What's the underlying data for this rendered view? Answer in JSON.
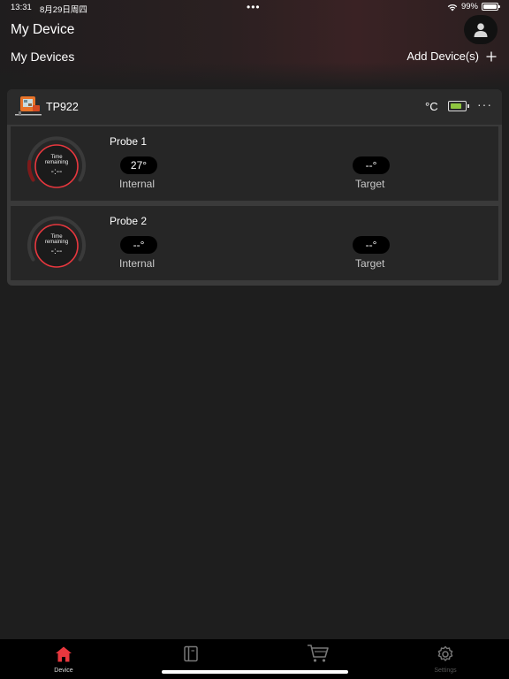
{
  "status_bar": {
    "time": "13:31",
    "date": "8月29日周四",
    "dots": "•••",
    "battery": "99%"
  },
  "header": {
    "title": "My Device"
  },
  "section": {
    "title": "My Devices",
    "add_label": "Add Device(s)"
  },
  "device": {
    "name": "TP922",
    "unit": "°C",
    "battery_level": 0.7,
    "more": "···",
    "probes": [
      {
        "name": "Probe  1",
        "gauge_line1": "Time",
        "gauge_line2": "remaining",
        "gauge_value": "-:--",
        "internal_value": "27°",
        "internal_label": "Internal",
        "target_value": "--°",
        "target_label": "Target"
      },
      {
        "name": "Probe  2",
        "gauge_line1": "Time",
        "gauge_line2": "remaining",
        "gauge_value": "-:--",
        "internal_value": "--°",
        "internal_label": "Internal",
        "target_value": "--°",
        "target_label": "Target"
      }
    ]
  },
  "tabs": [
    {
      "label": "Device",
      "icon": "home-icon",
      "active": true
    },
    {
      "label": "",
      "icon": "book-icon",
      "active": false
    },
    {
      "label": "",
      "icon": "cart-icon",
      "active": false
    },
    {
      "label": "Settings",
      "icon": "gear-icon",
      "active": false
    }
  ],
  "colors": {
    "accent": "#e8373e",
    "battery": "#8fc63f",
    "background": "#1e1e1e"
  }
}
